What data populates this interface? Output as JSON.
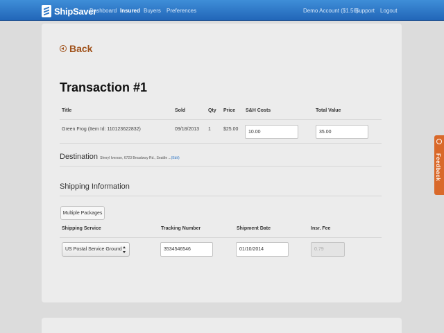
{
  "navbar": {
    "brand": "ShipSaver",
    "links": [
      "Dashboard",
      "Insured",
      "Buyers",
      "Preferences"
    ],
    "active": "Insured",
    "account": "Demo Account ($1.56)",
    "support": "Support",
    "logout": "Logout"
  },
  "back_label": "Back",
  "page_title": "Transaction #1",
  "items_table": {
    "headers": [
      "Title",
      "Sold",
      "Qty",
      "Price",
      "S&H Costs",
      "Total Value"
    ],
    "row": {
      "title": "Green Frog (Item Id: 110123622832)",
      "sold": "09/18/2013",
      "qty": "1",
      "price": "$25.00",
      "sh_costs": "10.00",
      "total_value": "35.00"
    }
  },
  "destination": {
    "label": "Destination",
    "address": "Sheryl Iverson, 6723 Broadway Rd., Seattle ...",
    "edit": "(Edit)"
  },
  "shipping": {
    "title": "Shipping Information",
    "multiple_packages": "Multiple Packages",
    "headers": [
      "Shipping Service",
      "Tracking Number",
      "Shipment Date",
      "Insr. Fee"
    ],
    "service": "US Postal Service Ground",
    "tracking": "3534546546",
    "date": "01/10/2014",
    "fee": "0.79"
  },
  "feedback_label": "Feedback",
  "colors": {
    "nav": "#2a74c5",
    "accent": "#a0521b",
    "feedback": "#d9692a"
  }
}
